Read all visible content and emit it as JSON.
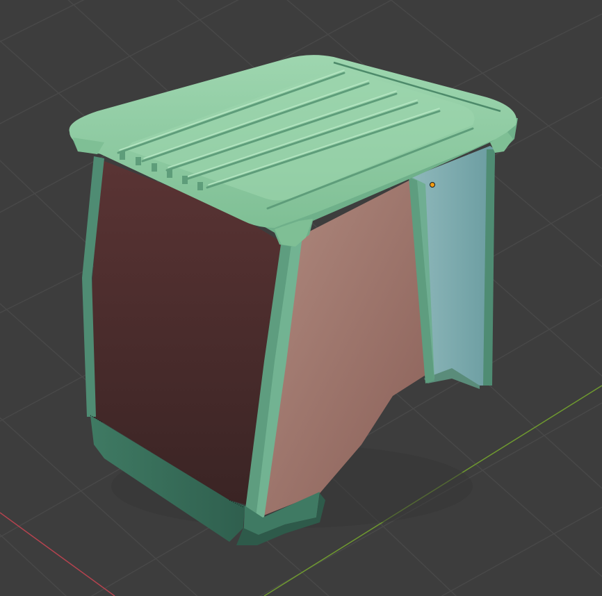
{
  "viewport": {
    "name": "3D Viewport",
    "colors": {
      "background": "#3d3d3d",
      "grid_line": "#4a4a4a",
      "x_axis": "#b5434f",
      "y_axis": "#6f9a2f",
      "lid": "#8fcca2",
      "lid_shadow": "#5e9d7a",
      "frame": "#4f8c73",
      "frame_dark": "#2e5a4a",
      "left_panel": "#4a2c2c",
      "front_panel": "#a17669",
      "side_panel": "#7aa8ab",
      "origin_point": "#f39c12"
    },
    "object": {
      "type": "mesh",
      "parts": [
        "lid",
        "left-panel",
        "front-panel",
        "side-panel",
        "frame",
        "base"
      ]
    },
    "origin_marker": "object-origin-dot"
  }
}
